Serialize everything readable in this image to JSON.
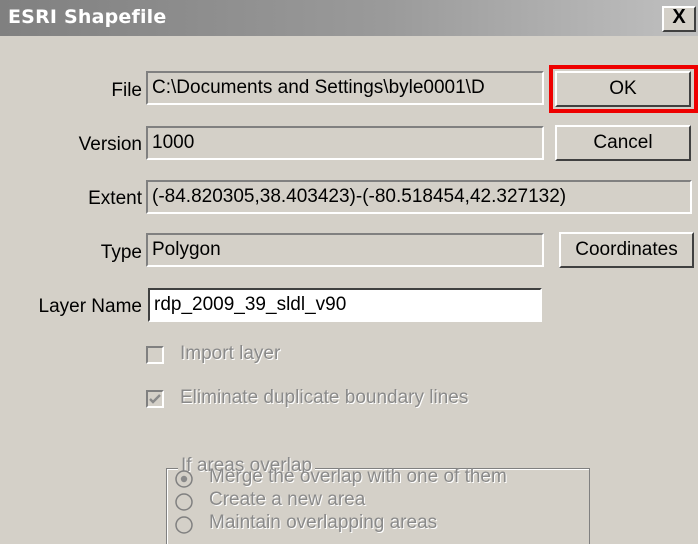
{
  "window": {
    "title": "ESRI Shapefile",
    "close_glyph": "X"
  },
  "labels": {
    "file": "File",
    "version": "Version",
    "extent": "Extent",
    "type": "Type",
    "layer_name": "Layer Name"
  },
  "fields": {
    "file": "C:\\Documents and Settings\\byle0001\\D",
    "version": "1000",
    "extent": "(-84.820305,38.403423)-(-80.518454,42.327132)",
    "type": "Polygon",
    "layer_name": "rdp_2009_39_sldl_v90"
  },
  "buttons": {
    "ok": "OK",
    "cancel": "Cancel",
    "coordinates": "Coordinates"
  },
  "options": {
    "import_layer": {
      "label": "Import layer",
      "checked": false,
      "enabled": false
    },
    "eliminate_duplicates": {
      "label": "Eliminate duplicate boundary lines",
      "checked": true,
      "enabled": false
    }
  },
  "overlap_group": {
    "legend": "If areas overlap",
    "choices": [
      {
        "label": "Merge the overlap with one of them",
        "selected": true
      },
      {
        "label": "Create a new area",
        "selected": false
      },
      {
        "label": "Maintain overlapping areas",
        "selected": false
      }
    ]
  },
  "colors": {
    "dialog_bg": "#d4d0c8",
    "highlight": "#ee0000",
    "disabled_text": "#8a8a8a"
  }
}
